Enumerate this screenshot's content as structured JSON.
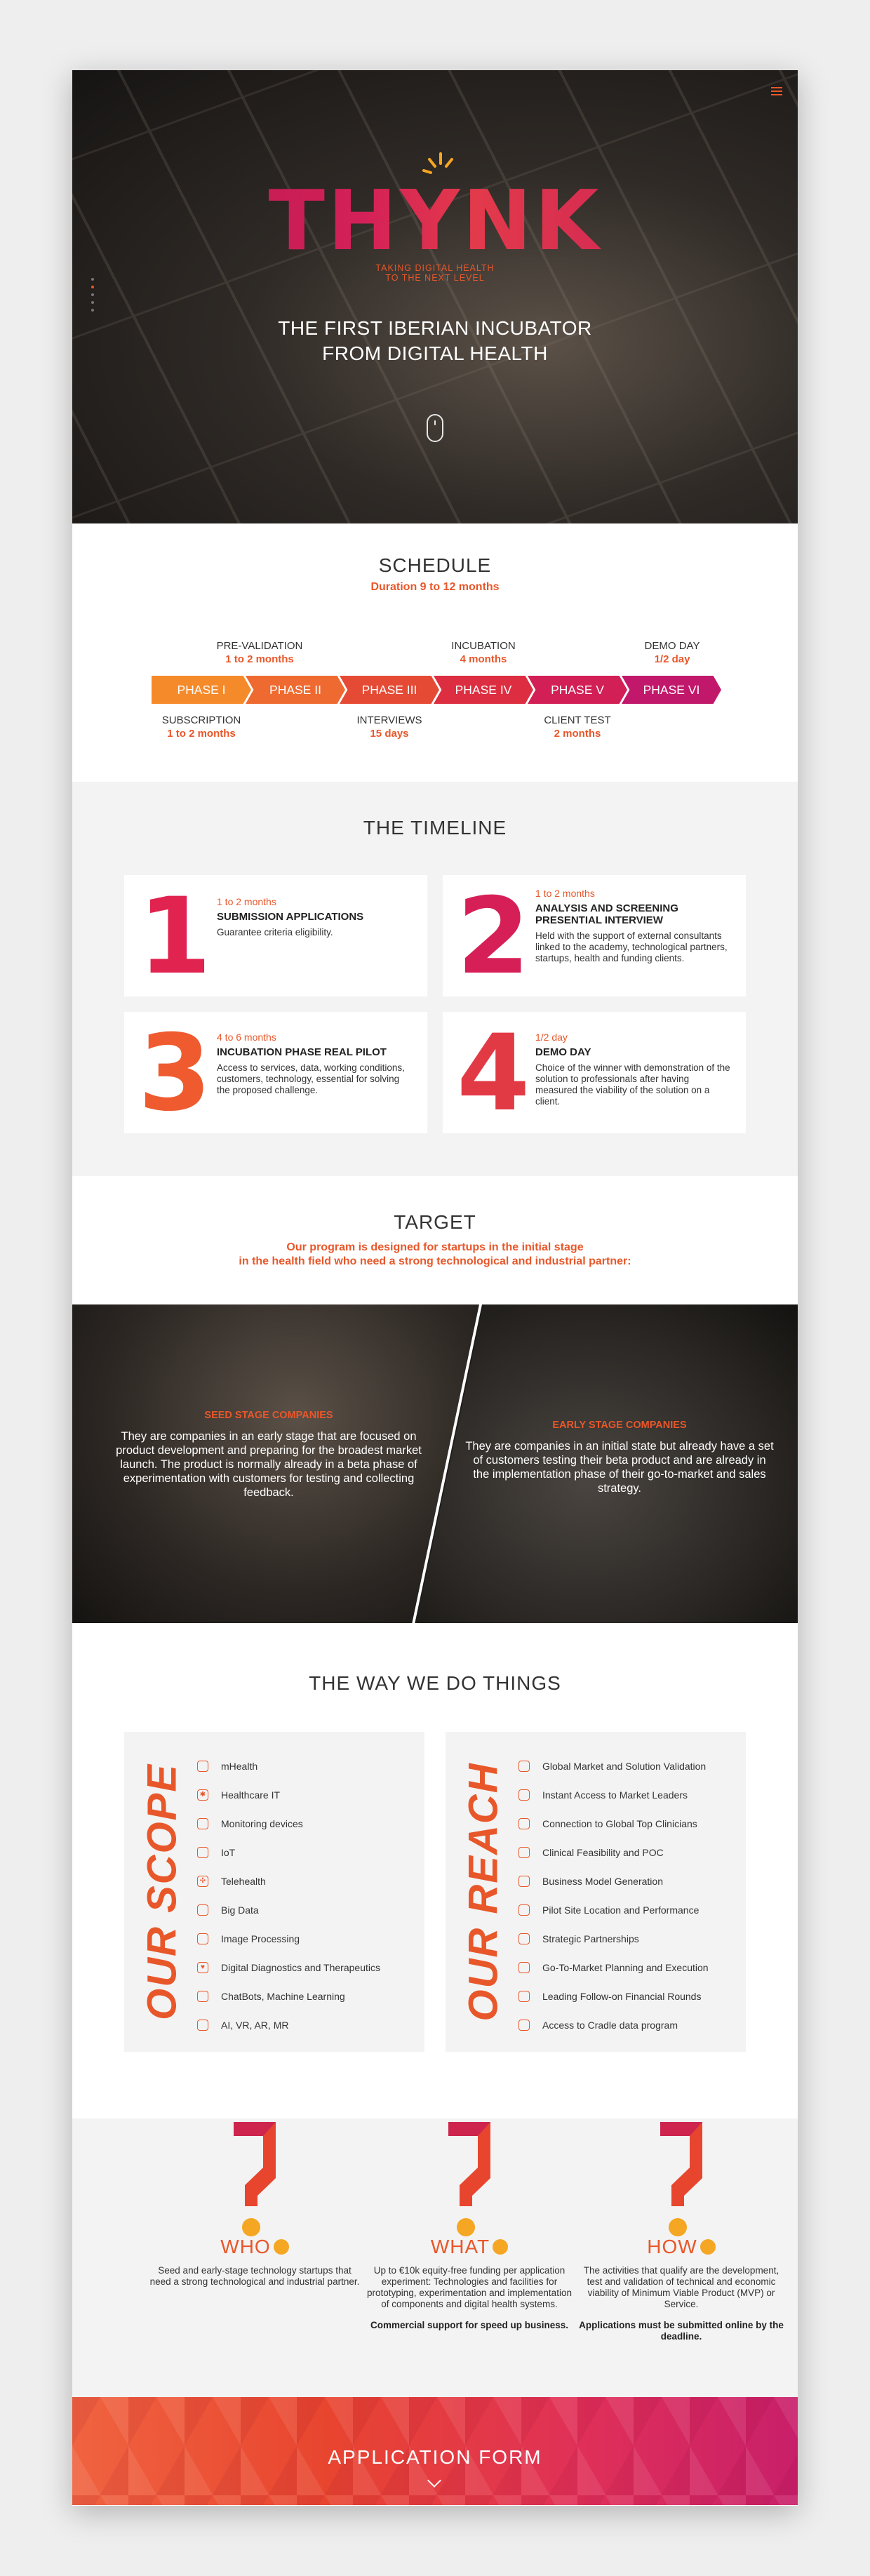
{
  "hero": {
    "logo_text": "THYNK",
    "tagline_1": "TAKING DIGITAL HEALTH",
    "tagline_2": "TO THE NEXT LEVEL",
    "headline_1": "THE FIRST IBERIAN INCUBATOR",
    "headline_2": "FROM DIGITAL HEALTH"
  },
  "schedule": {
    "title": "SCHEDULE",
    "duration": "Duration 9 to 12 months",
    "phases": [
      "PHASE I",
      "PHASE II",
      "PHASE III",
      "PHASE IV",
      "PHASE V",
      "PHASE VI"
    ],
    "phase_colors": [
      "#f58a2b",
      "#ee6a30",
      "#e54a35",
      "#dc2e40",
      "#d21f56",
      "#c2186b"
    ],
    "above": [
      {
        "label": "PRE-VALIDATION",
        "value": "1 to 2 months"
      },
      {
        "label": "INCUBATION",
        "value": "4 months"
      },
      {
        "label": "DEMO DAY",
        "value": "1/2 day"
      }
    ],
    "below": [
      {
        "label": "SUBSCRIPTION",
        "value": "1 to 2 months"
      },
      {
        "label": "INTERVIEWS",
        "value": "15 days"
      },
      {
        "label": "CLIENT TEST",
        "value": "2 months"
      }
    ]
  },
  "timeline": {
    "title": "THE TIMELINE",
    "cards": [
      {
        "num": "1",
        "duration": "1 to 2 months",
        "title": "SUBMISSION APPLICATIONS",
        "text": "Guarantee criteria eligibility."
      },
      {
        "num": "2",
        "duration": "1 to 2 months",
        "title": "ANALYSIS AND SCREENING PRESENTIAL INTERVIEW",
        "text": "Held with the support of external consultants linked to the academy, technological partners, startups, health and funding clients."
      },
      {
        "num": "3",
        "duration": "4 to 6 months",
        "title": "INCUBATION PHASE REAL PILOT",
        "text": "Access to services, data, working conditions, customers, technology, essential for solving the proposed challenge."
      },
      {
        "num": "4",
        "duration": "1/2 day",
        "title": "DEMO DAY",
        "text": "Choice of the winner with demonstration of the solution to professionals after having measured the viability of the solution on a client."
      }
    ]
  },
  "target": {
    "title": "TARGET",
    "subtitle_1": "Our program is designed for startups in the initial stage",
    "subtitle_2": "in the health field who need a strong technological and industrial partner:",
    "seed": {
      "title": "SEED STAGE COMPANIES",
      "text": "They are companies in an early stage that are focused on product development and preparing for the broadest market launch. The product is normally already in a beta phase of experimentation with customers for testing and collecting feedback."
    },
    "early": {
      "title": "EARLY STAGE COMPANIES",
      "text": "They are companies in an initial state but already have a set of customers testing their beta product and are already in the implementation phase of their go-to-market and sales strategy."
    }
  },
  "way": {
    "title": "THE WAY WE DO THINGS",
    "scope": {
      "label": "OUR SCOPE",
      "items": [
        "mHealth",
        "Healthcare IT",
        "Monitoring devices",
        "IoT",
        "Telehealth",
        "Big Data",
        "Image Processing",
        "Digital Diagnostics and Therapeutics",
        "ChatBots, Machine Learning",
        "AI, VR, AR, MR"
      ]
    },
    "reach": {
      "label": "OUR REACH",
      "items": [
        "Global Market and Solution Validation",
        "Instant Access to Market Leaders",
        "Connection to Global Top Clinicians",
        "Clinical Feasibility and POC",
        "Business Model Generation",
        "Pilot Site Location and Performance",
        "Strategic Partnerships",
        "Go-To-Market Planning and Execution",
        "Leading Follow-on Financial Rounds",
        "Access to Cradle data program"
      ]
    }
  },
  "questions": [
    {
      "head": "WHO",
      "text": "Seed and early-stage technology startups that need a strong technological and industrial partner.",
      "bold": ""
    },
    {
      "head": "WHAT",
      "text": "Up to €10k equity-free funding per application experiment: Technologies and facilities for prototyping, experimentation and implementation of components and digital health systems.",
      "bold": "Commercial support for speed up business."
    },
    {
      "head": "HOW",
      "text": "The activities that qualify are the development, test and validation of technical and economic viability of Minimum Viable Product (MVP) or Service.",
      "bold": "Applications must be submitted online by the deadline."
    }
  ],
  "form": {
    "label": "APPLICATION FORM"
  },
  "colors": {
    "accent": "#e8572a",
    "magenta": "#c2185b",
    "bg_light": "#f3f3f3"
  }
}
